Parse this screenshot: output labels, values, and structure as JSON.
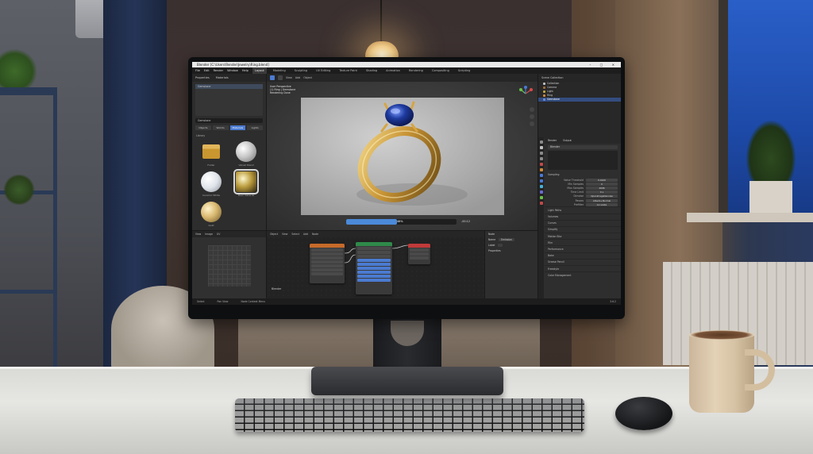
{
  "window": {
    "title": "Blender [C:\\Users\\Render\\Jewelry\\Ring.blend]",
    "controls": "– ▢ ✕"
  },
  "menubar": {
    "items": [
      "File",
      "Edit",
      "Render",
      "Window",
      "Help"
    ],
    "workspaces": [
      "Layout",
      "Modeling",
      "Sculpting",
      "UV Editing",
      "Texture Paint",
      "Shading",
      "Animation",
      "Rendering",
      "Compositing",
      "Scripting"
    ],
    "active_workspace": "Layout"
  },
  "left_panel": {
    "header": [
      "Properties",
      "Materials"
    ],
    "search": "Gemstone",
    "tabs": [
      "Objects",
      "Worlds",
      "Materials",
      "Lights"
    ],
    "active_tab": "Materials",
    "section": "Library",
    "assets": [
      {
        "label": "Folder",
        "icon": "folder"
      },
      {
        "label": "Velvet Stand",
        "icon": "velvet"
      },
      {
        "label": "Ceramic White",
        "icon": "ceramic"
      },
      {
        "label": "Pearl Material",
        "icon": "pearl"
      },
      {
        "label": "Gold",
        "icon": "gold"
      }
    ],
    "selected_asset": "Pearl Material"
  },
  "viewport": {
    "header": [
      "View",
      "Add",
      "Object"
    ],
    "overlay": [
      "User Perspective",
      "(1) Ring | Gemstone",
      "Rendering Done"
    ],
    "progress": 0.46,
    "progress_label": "46%",
    "time_label": "-00:12"
  },
  "outliner": {
    "title": "Scene Collection",
    "rows": [
      {
        "label": "Collection",
        "color": "#c0c0c0",
        "selected": false
      },
      {
        "label": "Camera",
        "color": "#a06a3a",
        "selected": false
      },
      {
        "label": "Light",
        "color": "#c6a63a",
        "selected": false
      },
      {
        "label": "Ring",
        "color": "#d08a3a",
        "selected": false
      },
      {
        "label": "Gemstone",
        "color": "#6a8ad8",
        "selected": true
      }
    ]
  },
  "properties": {
    "tabs": [
      "Render",
      "Output"
    ],
    "object_field": "Blender",
    "section_sampling": "Sampling",
    "rows": [
      {
        "label": "Noise Threshold",
        "value": "0.0100"
      },
      {
        "label": "Min Samples",
        "value": "0"
      },
      {
        "label": "Max Samples",
        "value": "4096"
      },
      {
        "label": "Time Limit",
        "value": "0 s"
      },
      {
        "label": "Denoise",
        "value": "OpenImageDenoise"
      },
      {
        "label": "Passes",
        "value": "Albedo+Normal"
      },
      {
        "label": "Prefilter",
        "value": "Accurate"
      }
    ],
    "collapsed": [
      "Light Paths",
      "Volumes",
      "Curves",
      "Simplify",
      "Motion Blur",
      "Film",
      "Performance",
      "Bake",
      "Grease Pencil",
      "Freestyle",
      "Color Management"
    ]
  },
  "uv_editor": {
    "header": [
      "View",
      "Image",
      "UV"
    ]
  },
  "node_editor": {
    "header": [
      "Object",
      "View",
      "Select",
      "Add",
      "Node"
    ],
    "label": "Blender"
  },
  "side_panel": {
    "title": "Node",
    "rows": [
      {
        "label": "Name",
        "value": "Emission"
      },
      {
        "label": "Label",
        "value": ""
      }
    ],
    "section": "Properties"
  },
  "statusbar": [
    "Select",
    "Pan View",
    "Node Context Menu",
    "3.6.2"
  ],
  "colors": {
    "accent": "#4b7bd1",
    "gem": "#1e3a9e",
    "gold": "#d6a542"
  }
}
